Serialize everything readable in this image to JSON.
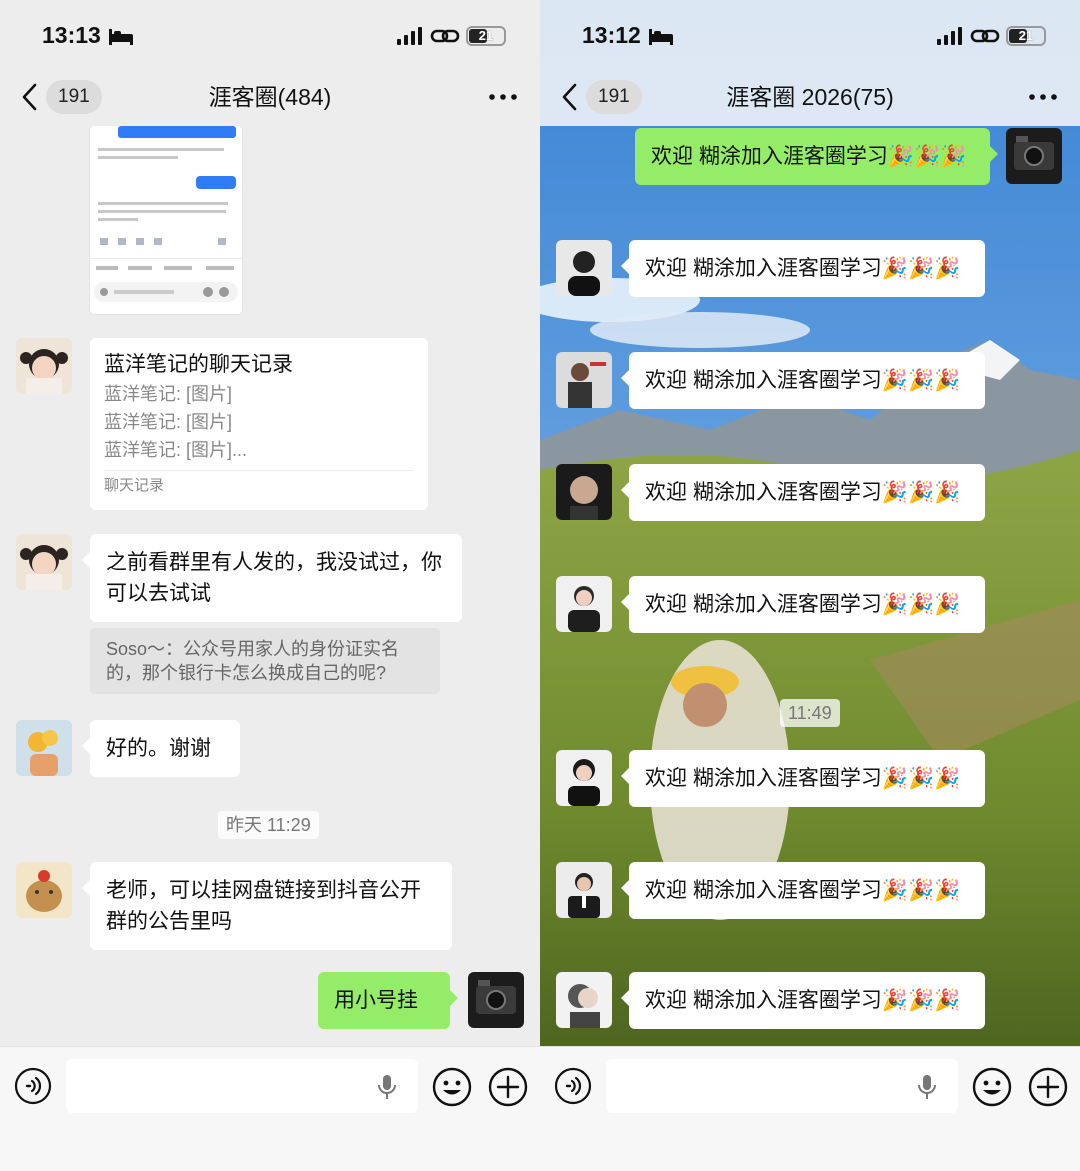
{
  "colors": {
    "app_bg": "#ededed",
    "bubble_green": "#95ec69",
    "bubble_white": "#ffffff",
    "muted_text": "#888888"
  },
  "left": {
    "status": {
      "time": "13:13",
      "battery": "21"
    },
    "header": {
      "back_count": "191",
      "title": "涯客圈(484)"
    },
    "record_card": {
      "title": "蓝洋笔记的聊天记录",
      "lines": [
        "蓝洋笔记: [图片]",
        "蓝洋笔记: [图片]",
        "蓝洋笔记: [图片]..."
      ],
      "footer": "聊天记录"
    },
    "messages": {
      "m2": "之前看群里有人发的，我没试过，你可以去试试",
      "quote": "Soso～：公众号用家人的身份证实名的，那个银行卡怎么换成自己的呢?",
      "m3": "好的。谢谢",
      "timestamp": "昨天 11:29",
      "m4": "老师，可以挂网盘链接到抖音公开群的公告里吗",
      "m5": "用小号挂"
    }
  },
  "right": {
    "status": {
      "time": "13:12",
      "battery": "21"
    },
    "header": {
      "back_count": "191",
      "title": "涯客圈 2026(75)"
    },
    "welcome_text": "欢迎 糊涂加入涯客圈学习🎉🎉🎉",
    "timestamp": "11:49"
  },
  "icons": {
    "back": "chevron-left-icon",
    "more": "more-dots-icon",
    "voice": "voice-icon",
    "mic": "microphone-icon",
    "emoji": "emoji-icon",
    "plus": "plus-icon",
    "sleep": "bed-icon",
    "signal": "signal-icon",
    "link": "link-icon"
  }
}
